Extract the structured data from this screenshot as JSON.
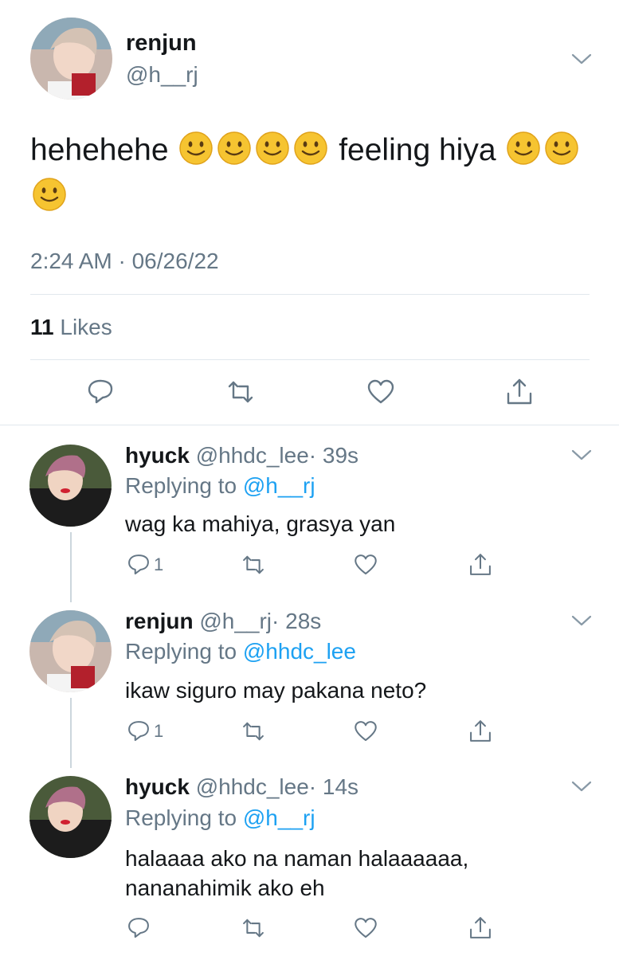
{
  "main": {
    "name": "renjun",
    "handle": "@h__rj",
    "text": "hehehehe",
    "text2": "feeling hiya",
    "timestamp": "2:24 AM · 06/26/22",
    "likes_count": "11",
    "likes_label": "Likes"
  },
  "replies": [
    {
      "name": "hyuck",
      "handle": "@hhdc_lee",
      "time": "· 39s",
      "replying_prefix": "Replying to",
      "replying_handle": "@h__rj",
      "text1": "wag ka mahiya, grasya yan",
      "text2": "",
      "reply_count": "1"
    },
    {
      "name": "renjun",
      "handle": "@h__rj",
      "time": "· 28s",
      "replying_prefix": "Replying to",
      "replying_handle": "@hhdc_lee",
      "text1": "ikaw siguro may pakana neto?",
      "text2": "",
      "reply_count": "1"
    },
    {
      "name": "hyuck",
      "handle": "@hhdc_lee",
      "time": "· 14s",
      "replying_prefix": "Replying to",
      "replying_handle": "@h__rj",
      "text1": "halaaaa ako na naman halaaaaaa,",
      "text2": "nananahimik ako eh",
      "reply_count": ""
    }
  ],
  "colors": {
    "accent": "#1da1f2",
    "muted": "#657786",
    "divider": "#e1e8ed",
    "text": "#14171a"
  },
  "icons": [
    "chevron-down-icon",
    "reply-icon",
    "retweet-icon",
    "like-icon",
    "share-icon",
    "smile-emoji-icon"
  ]
}
